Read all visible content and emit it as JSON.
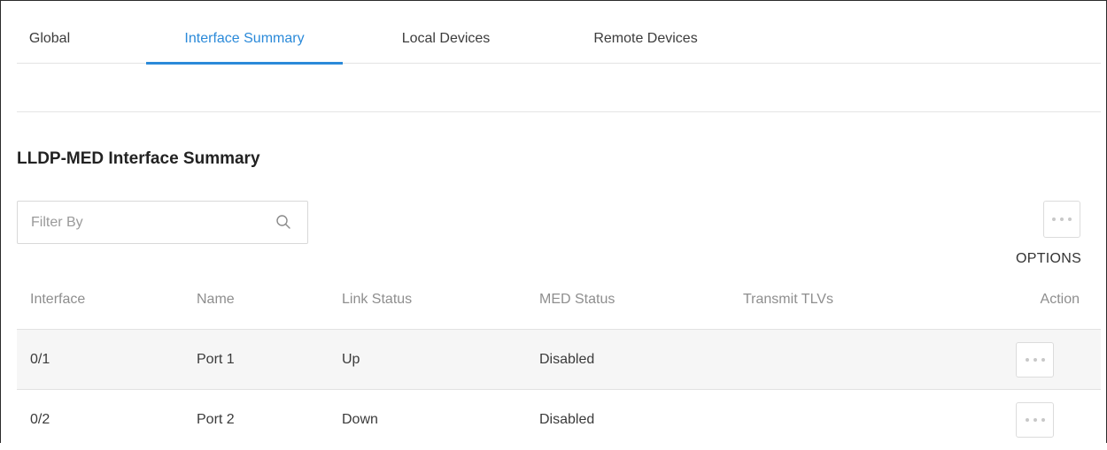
{
  "tabs": [
    {
      "label": "Global",
      "active": false
    },
    {
      "label": "Interface Summary",
      "active": true
    },
    {
      "label": "Local Devices",
      "active": false
    },
    {
      "label": "Remote Devices",
      "active": false
    }
  ],
  "section_title": "LLDP-MED Interface Summary",
  "filter": {
    "placeholder": "Filter By",
    "value": "",
    "icon": "search-icon"
  },
  "options": {
    "label": "OPTIONS",
    "icon": "more-dots-icon"
  },
  "table": {
    "headers": [
      "Interface",
      "Name",
      "Link Status",
      "MED Status",
      "Transmit TLVs",
      "Action"
    ],
    "rows": [
      {
        "interface": "0/1",
        "name": "Port 1",
        "link_status": "Up",
        "med_status": "Disabled",
        "transmit_tlvs": ""
      },
      {
        "interface": "0/2",
        "name": "Port 2",
        "link_status": "Down",
        "med_status": "Disabled",
        "transmit_tlvs": ""
      }
    ]
  },
  "colors": {
    "accent": "#2b8ad9",
    "header_text": "#8e8e8e",
    "row_shade": "#f6f6f6"
  }
}
